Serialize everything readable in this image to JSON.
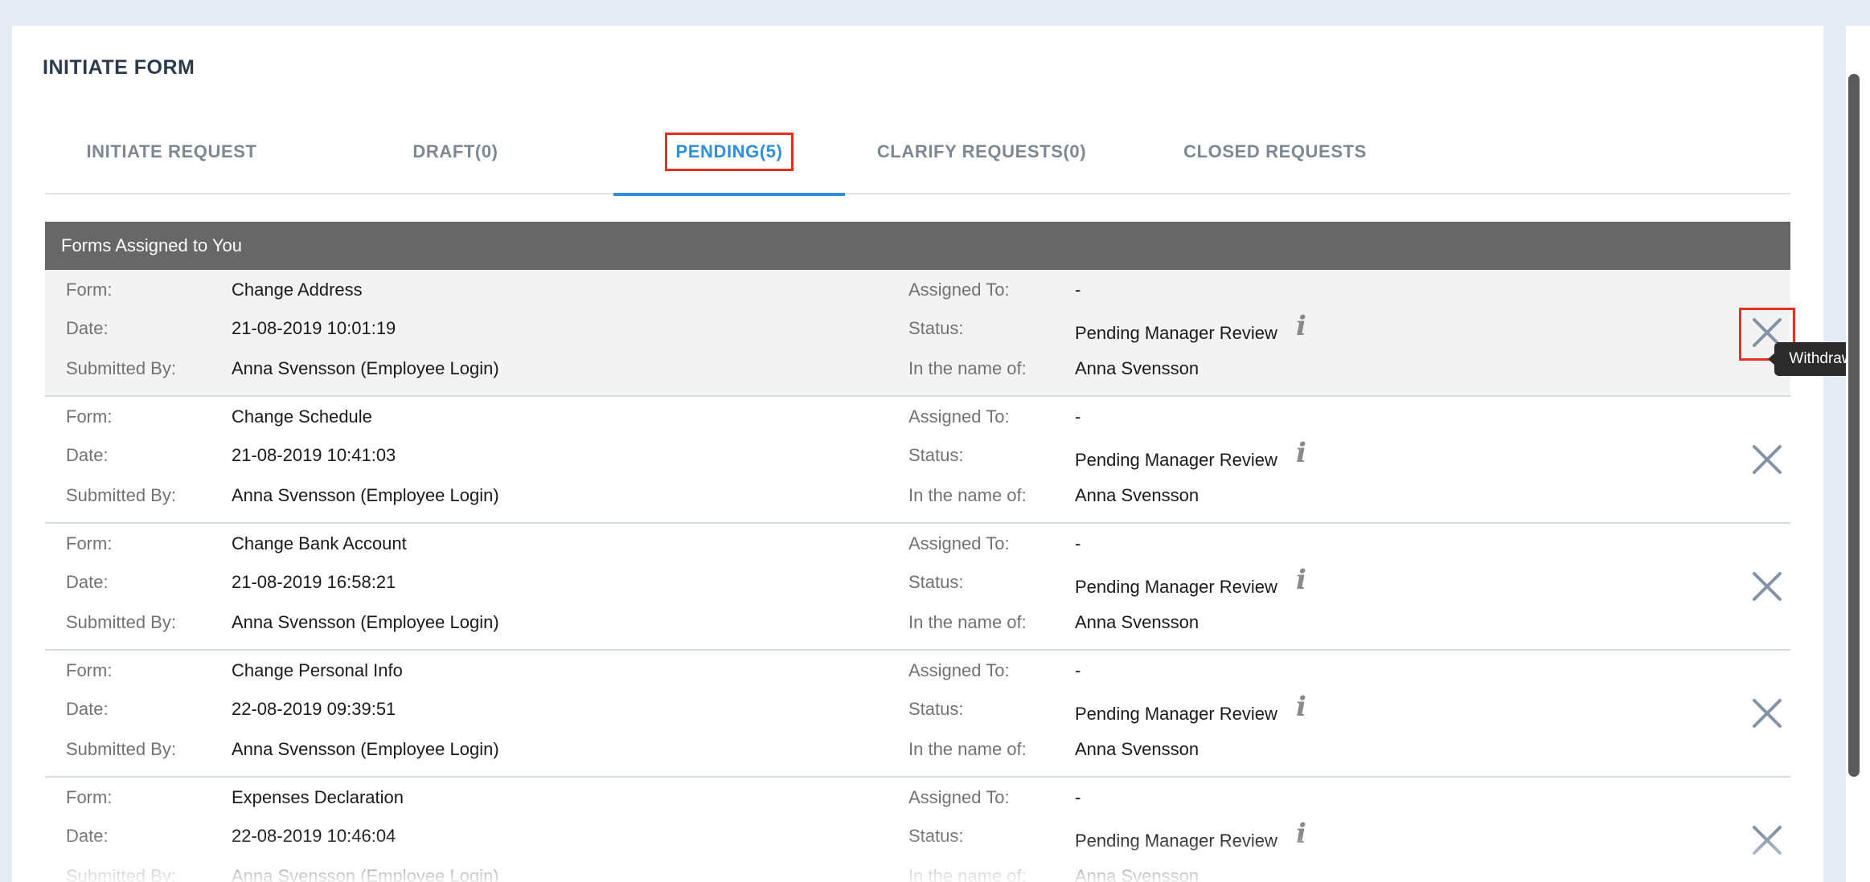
{
  "page": {
    "title": "INITIATE FORM"
  },
  "tabs": [
    {
      "label": "INITIATE REQUEST",
      "active": false
    },
    {
      "label": "DRAFT(0)",
      "active": false
    },
    {
      "label": "PENDING(5)",
      "active": true
    },
    {
      "label": "CLARIFY REQUESTS(0)",
      "active": false
    },
    {
      "label": "CLOSED REQUESTS",
      "active": false
    }
  ],
  "section": {
    "title": "Forms Assigned to You"
  },
  "labels": {
    "form": "Form:",
    "date": "Date:",
    "submitted_by": "Submitted By:",
    "assigned_to": "Assigned To:",
    "status": "Status:",
    "in_name_of": "In the name of:"
  },
  "forms": [
    {
      "form": "Change Address",
      "date": "21-08-2019 10:01:19",
      "submitted_by": "Anna Svensson (Employee Login)",
      "assigned_to": "-",
      "status": "Pending Manager Review",
      "in_name_of": "Anna Svensson"
    },
    {
      "form": "Change Schedule",
      "date": "21-08-2019 10:41:03",
      "submitted_by": "Anna Svensson (Employee Login)",
      "assigned_to": "-",
      "status": "Pending Manager Review",
      "in_name_of": "Anna Svensson"
    },
    {
      "form": "Change Bank Account",
      "date": "21-08-2019 16:58:21",
      "submitted_by": "Anna Svensson (Employee Login)",
      "assigned_to": "-",
      "status": "Pending Manager Review",
      "in_name_of": "Anna Svensson"
    },
    {
      "form": "Change Personal Info",
      "date": "22-08-2019 09:39:51",
      "submitted_by": "Anna Svensson (Employee Login)",
      "assigned_to": "-",
      "status": "Pending Manager Review",
      "in_name_of": "Anna Svensson"
    },
    {
      "form": "Expenses Declaration",
      "date": "22-08-2019 10:46:04",
      "submitted_by": "Anna Svensson (Employee Login)",
      "assigned_to": "-",
      "status": "Pending Manager Review",
      "in_name_of": "Anna Svensson"
    }
  ],
  "icons": {
    "info": "info-icon",
    "withdraw": "close-icon"
  },
  "tooltip": {
    "text": "Withdraw"
  },
  "colors": {
    "accent": "#2f8fdb",
    "highlight": "#e2321f",
    "header_bg": "#676767"
  }
}
